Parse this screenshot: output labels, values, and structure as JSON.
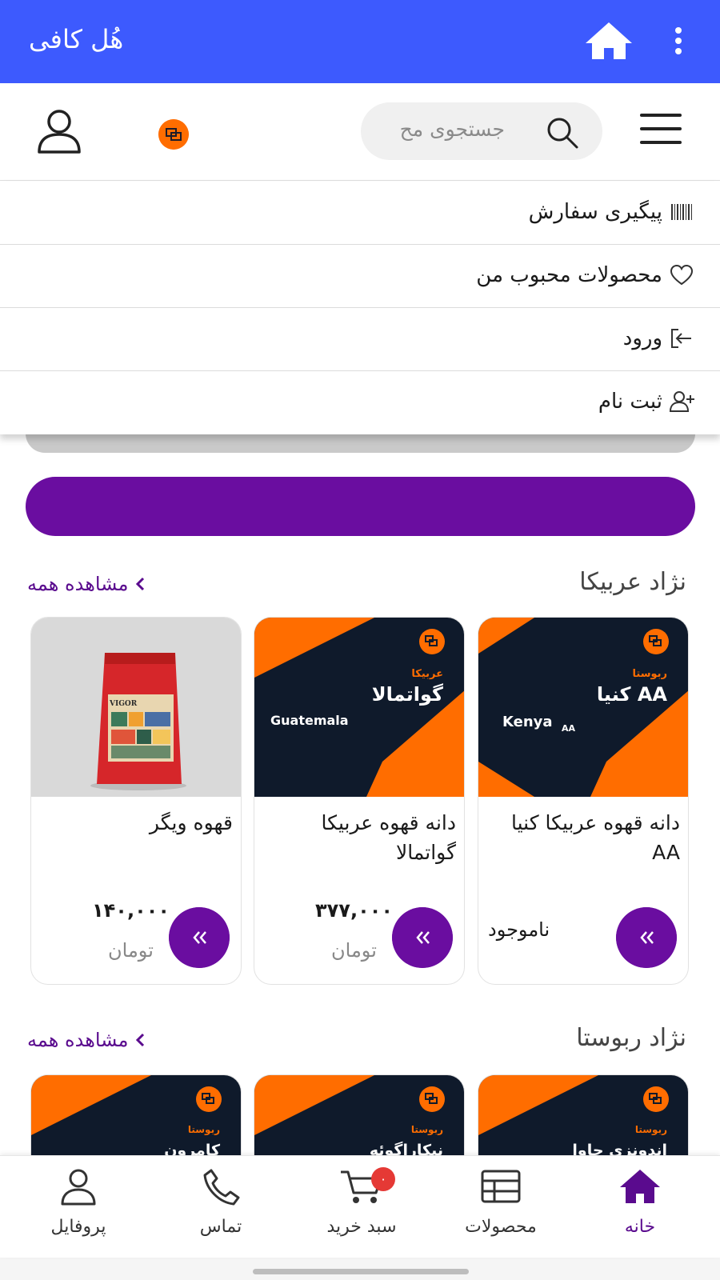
{
  "app": {
    "title": "هُل کافی",
    "accent": "#3d5afe",
    "primary": "#6a0da0",
    "brand_orange": "#ff6d00"
  },
  "header": {
    "search_placeholder": "جستجوی مح",
    "search_icon": "search-icon",
    "menu_icon": "hamburger-icon",
    "user_icon": "user-icon"
  },
  "menu": {
    "items": [
      {
        "label": "پیگیری سفارش",
        "icon": "barcode-icon"
      },
      {
        "label": "محصولات محبوب من",
        "icon": "heart-icon"
      },
      {
        "label": "ورود",
        "icon": "login-icon"
      },
      {
        "label": "ثبت نام",
        "icon": "user-plus-icon"
      }
    ]
  },
  "sections": [
    {
      "title": "نژاد عربیکا",
      "see_all": "مشاهده همه",
      "products": [
        {
          "name": "دانه قهوه عربیکا کنیا AA",
          "status": "ناموجود",
          "art_small": "ربوستا",
          "art_fa": "کنیا AA",
          "art_en": "Kenya",
          "art_sub": "AA"
        },
        {
          "name": "دانه قهوه عربیکا گواتمالا",
          "price": "۳۷۷,۰۰۰",
          "currency": "تومان",
          "art_small": "عربیکا",
          "art_fa": "گواتمالا",
          "art_en": "Guatemala"
        },
        {
          "name": "قهوه ویگر",
          "price": "۱۴۰,۰۰۰",
          "currency": "تومان",
          "pack_brand": "VIGOR"
        }
      ]
    },
    {
      "title": "نژاد ربوستا",
      "see_all": "مشاهده همه",
      "products": [
        {
          "art_small": "ربوستا",
          "art_fa": "اندونزی جاوا"
        },
        {
          "art_small": "ربوستا",
          "art_fa": "نیکاراگوئه"
        },
        {
          "art_small": "ربوستا",
          "art_fa": "کامرون"
        }
      ]
    }
  ],
  "bottom_nav": {
    "items": [
      {
        "label": "خانه",
        "icon": "home-icon",
        "active": true
      },
      {
        "label": "محصولات",
        "icon": "grid-icon"
      },
      {
        "label": "سبد خرید",
        "icon": "cart-icon",
        "badge": "۰"
      },
      {
        "label": "تماس",
        "icon": "phone-icon"
      },
      {
        "label": "پروفایل",
        "icon": "profile-icon"
      }
    ]
  }
}
